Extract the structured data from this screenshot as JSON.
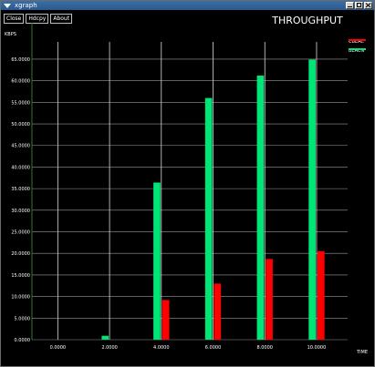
{
  "window": {
    "title": "xgraph"
  },
  "toolbar": {
    "close_label": "Close",
    "hdcpy_label": "Hdcpy",
    "about_label": "About"
  },
  "chart_data": {
    "type": "bar",
    "title": "THROUGHPUT",
    "xlabel": "TIME",
    "ylabel": "KBPS",
    "x_ticks": [
      "0.0000",
      "2.0000",
      "4.0000",
      "6.0000",
      "8.0000",
      "10.0000"
    ],
    "y_ticks": [
      "0.0000",
      "5.0000",
      "10.0000",
      "15.0000",
      "20.0000",
      "25.0000",
      "30.0000",
      "35.0000",
      "40.0000",
      "45.0000",
      "50.0000",
      "55.0000",
      "60.0000",
      "65.0000"
    ],
    "xlim": [
      -1.0,
      11.2
    ],
    "ylim": [
      0,
      69
    ],
    "grid": true,
    "legend_position": "top-right",
    "series": [
      {
        "name": "CBEAC",
        "color": "#ff0000",
        "x": [
          4,
          6,
          8,
          10
        ],
        "values": [
          9.2,
          13.0,
          18.7,
          20.5
        ]
      },
      {
        "name": "BEACN",
        "color": "#00e676",
        "x": [
          2,
          4,
          6,
          8,
          10
        ],
        "values": [
          0.9,
          36.4,
          56.0,
          61.2,
          64.9
        ]
      }
    ]
  }
}
